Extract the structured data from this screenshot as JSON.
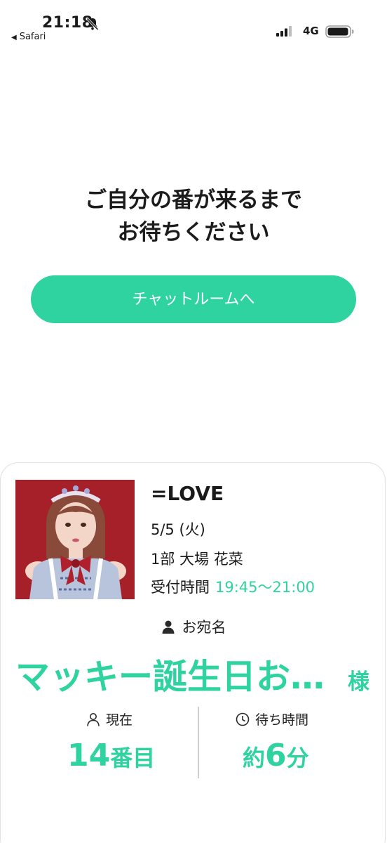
{
  "status_bar": {
    "time": "21:18",
    "back_app": "Safari",
    "network": "4G",
    "icons": [
      "bell-mute-icon",
      "signal-icon",
      "battery-icon"
    ]
  },
  "waiting": {
    "message_line1": "ご自分の番が来るまで",
    "message_line2": "お待ちください",
    "chat_button_label": "チャットルームへ"
  },
  "ticket": {
    "group_name": "=LOVE",
    "date": "5/5 (火)",
    "session": "1部  大場 花菜",
    "reception_label": "受付時間",
    "reception_time": "19:45〜21:00",
    "addressee_label": "お宛名",
    "addressee_name": "マッキー誕生日お…",
    "honorific": "様",
    "current_label": "現在",
    "current_number": "14",
    "current_unit": "番目",
    "wait_label": "待ち時間",
    "wait_prefix": "約",
    "wait_number": "6",
    "wait_unit": "分"
  },
  "colors": {
    "accent": "#2ed3a0",
    "photo_background": "#a6202a"
  }
}
